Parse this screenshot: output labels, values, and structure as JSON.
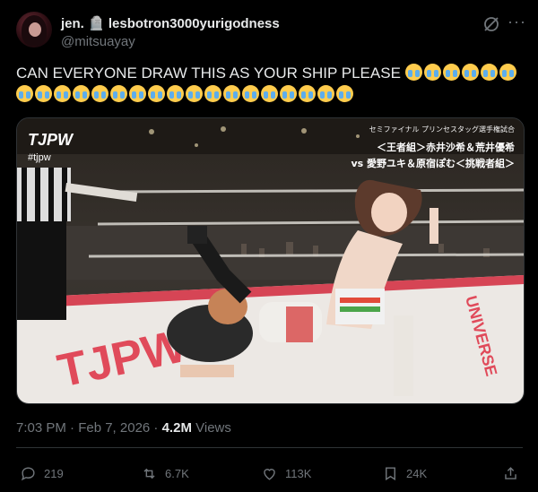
{
  "author": {
    "display_name": "jen. 🪦 lesbotron3000yurigodness",
    "handle": "@mitsuayay"
  },
  "post": {
    "text": "CAN EVERYONE DRAW THIS AS YOUR SHIP PLEASE",
    "emoji_count": 24,
    "emoji": "loudly-crying-face",
    "timestamp": "7:03 PM · Feb 7, 2026 · ",
    "views_count": "4.2M",
    "views_label": "Views"
  },
  "media": {
    "logo": "TJPW",
    "hashtag": "#tjpw",
    "caption_line1": "セミファイナル プリンセスタッグ選手権試合",
    "caption_line2": "＜王者組＞赤井沙希＆荒井優希",
    "caption_line3": "vs 愛野ユキ＆原宿ぽむ＜挑戦者組＞",
    "mat_text_left": "TJPW",
    "mat_text_right": "UNIVERSE"
  },
  "actions": {
    "replies": "219",
    "reposts": "6.7K",
    "likes": "113K",
    "bookmarks": "24K"
  },
  "colors": {
    "background": "#000000",
    "text_primary": "#e7e9ea",
    "text_secondary": "#71767b",
    "mat_red": "#e04a5a",
    "border": "#2f3336"
  }
}
